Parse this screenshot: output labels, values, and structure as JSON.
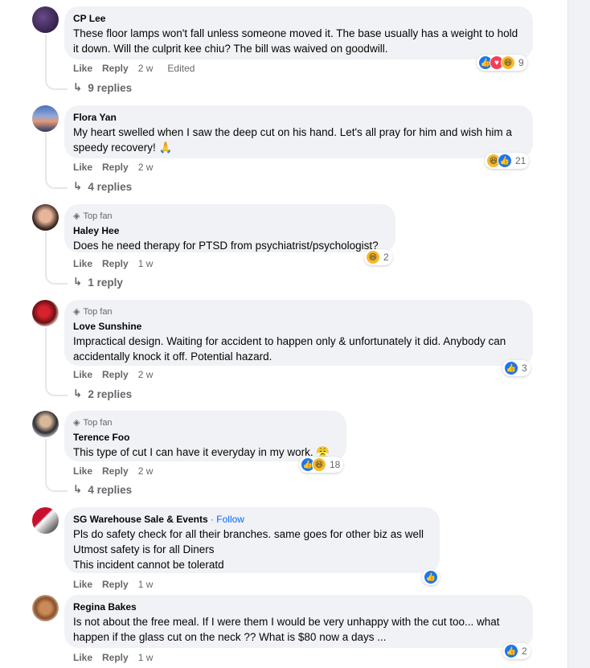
{
  "colors": {
    "like": "#1877f2",
    "love": "#f33e58",
    "haha": "#f7b928",
    "follow": "#0866ff"
  },
  "comments": [
    {
      "author": "CP Lee",
      "text": "These floor lamps won't fall unless someone moved it. The base usually has a weight to hold it down. Will the culprit kee chiu? The bill was waived on goodwill.",
      "like": "Like",
      "reply": "Reply",
      "time": "2 w",
      "edited": "Edited",
      "reactions": [
        "like",
        "love",
        "haha"
      ],
      "reaction_count": "9",
      "replies": "9 replies"
    },
    {
      "author": "Flora Yan",
      "text": "My heart swelled when I saw the deep cut on his hand. Let's all pray for him and wish him a speedy recovery! 🙏",
      "like": "Like",
      "reply": "Reply",
      "time": "2 w",
      "reactions": [
        "haha",
        "like"
      ],
      "reaction_count": "21",
      "replies": "4 replies"
    },
    {
      "badge": "Top fan",
      "author": "Haley Hee",
      "text": "Does he need therapy for PTSD from psychiatrist/psychologist?",
      "like": "Like",
      "reply": "Reply",
      "time": "1 w",
      "reactions": [
        "haha"
      ],
      "reaction_count": "2",
      "replies": "1 reply"
    },
    {
      "badge": "Top fan",
      "author": "Love Sunshine",
      "text": "Impractical design. Waiting for accident to happen only & unfortunately it did. Anybody can accidentally knock it off. Potential hazard.",
      "like": "Like",
      "reply": "Reply",
      "time": "2 w",
      "reactions": [
        "like"
      ],
      "reaction_count": "3",
      "replies": "2 replies"
    },
    {
      "badge": "Top fan",
      "author": "Terence Foo",
      "text": "This type of cut I can have it everyday in my work. 😤",
      "like": "Like",
      "reply": "Reply",
      "time": "2 w",
      "reactions": [
        "like",
        "haha"
      ],
      "reaction_count": "18",
      "replies": "4 replies"
    },
    {
      "author": "SG Warehouse Sale & Events",
      "follow": "· Follow",
      "text_lines": [
        "Pls do safety check for all their branches. same goes for other biz as well",
        "Utmost safety is for all Diners",
        "This incident cannot be toleratd"
      ],
      "like": "Like",
      "reply": "Reply",
      "time": "1 w",
      "reactions": [
        "like"
      ]
    },
    {
      "author": "Regina Bakes",
      "text": "Is not about the free meal. If I were them I would be very unhappy with the cut too... what happen if the glass cut on the neck ?? What is $80 now a days ...",
      "like": "Like",
      "reply": "Reply",
      "time": "1 w",
      "reactions": [
        "like"
      ],
      "reaction_count": "2"
    }
  ],
  "icons": {
    "reply_arrow": "reply-arrow-icon",
    "diamond": "diamond-icon",
    "thumb": "thumbs-up-icon",
    "heart": "heart-icon",
    "laugh": "laugh-icon"
  }
}
